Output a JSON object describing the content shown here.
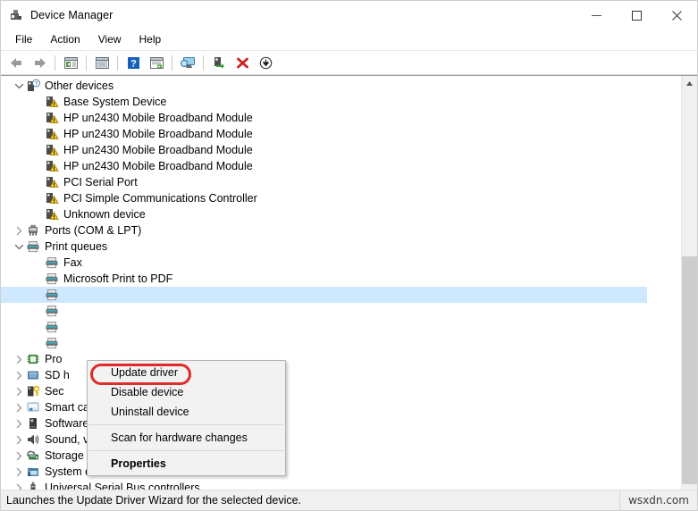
{
  "window": {
    "title": "Device Manager",
    "icon": "device-manager-icon",
    "controls": [
      {
        "name": "minimize-button",
        "glyph": "minimize"
      },
      {
        "name": "maximize-button",
        "glyph": "maximize"
      },
      {
        "name": "close-button",
        "glyph": "close"
      }
    ]
  },
  "menubar": {
    "items": [
      {
        "label": "File"
      },
      {
        "label": "Action"
      },
      {
        "label": "View"
      },
      {
        "label": "Help"
      }
    ]
  },
  "toolbar": {
    "buttons": [
      {
        "name": "back-icon",
        "title": "Back"
      },
      {
        "name": "forward-icon",
        "title": "Forward"
      },
      {
        "name": "show-hide-console-tree-icon",
        "title": "Show/Hide Console Tree"
      },
      {
        "name": "properties-icon",
        "title": "Properties"
      },
      {
        "name": "help-icon",
        "title": "Help"
      },
      {
        "name": "update-driver-icon",
        "title": "Update driver"
      },
      {
        "name": "scan-hardware-changes-icon",
        "title": "Scan for hardware changes"
      },
      {
        "name": "enable-device-icon",
        "title": "Enable device"
      },
      {
        "name": "uninstall-device-icon",
        "title": "Uninstall device"
      },
      {
        "name": "disable-device-icon",
        "title": "Disable device"
      }
    ]
  },
  "tree": {
    "nodes": [
      {
        "label": "Other devices",
        "icon": "unknown-device-icon",
        "indent": 1,
        "twisty": "expanded"
      },
      {
        "label": "Base System Device",
        "icon": "warning-device-icon",
        "indent": 2,
        "twisty": "none"
      },
      {
        "label": "HP un2430 Mobile Broadband Module",
        "icon": "warning-device-icon",
        "indent": 2,
        "twisty": "none"
      },
      {
        "label": "HP un2430 Mobile Broadband Module",
        "icon": "warning-device-icon",
        "indent": 2,
        "twisty": "none"
      },
      {
        "label": "HP un2430 Mobile Broadband Module",
        "icon": "warning-device-icon",
        "indent": 2,
        "twisty": "none"
      },
      {
        "label": "HP un2430 Mobile Broadband Module",
        "icon": "warning-device-icon",
        "indent": 2,
        "twisty": "none"
      },
      {
        "label": "PCI Serial Port",
        "icon": "warning-device-icon",
        "indent": 2,
        "twisty": "none"
      },
      {
        "label": "PCI Simple Communications Controller",
        "icon": "warning-device-icon",
        "indent": 2,
        "twisty": "none"
      },
      {
        "label": "Unknown device",
        "icon": "warning-device-icon",
        "indent": 2,
        "twisty": "none"
      },
      {
        "label": "Ports (COM & LPT)",
        "icon": "ports-icon",
        "indent": 1,
        "twisty": "collapsed"
      },
      {
        "label": "Print queues",
        "icon": "printer-icon",
        "indent": 1,
        "twisty": "expanded"
      },
      {
        "label": "Fax",
        "icon": "printer-icon",
        "indent": 2,
        "twisty": "none"
      },
      {
        "label": "Microsoft Print to PDF",
        "icon": "printer-icon",
        "indent": 2,
        "twisty": "none"
      },
      {
        "label": "",
        "icon": "printer-icon",
        "indent": 2,
        "twisty": "none",
        "selected": true
      },
      {
        "label": "",
        "icon": "printer-icon",
        "indent": 2,
        "twisty": "none"
      },
      {
        "label": "",
        "icon": "printer-icon",
        "indent": 2,
        "twisty": "none"
      },
      {
        "label": "",
        "icon": "printer-icon",
        "indent": 2,
        "twisty": "none"
      },
      {
        "label": "Pro",
        "icon": "processor-icon",
        "indent": 1,
        "twisty": "collapsed"
      },
      {
        "label": "SD h",
        "icon": "sd-host-icon",
        "indent": 1,
        "twisty": "collapsed"
      },
      {
        "label": "Sec",
        "icon": "security-devices-icon",
        "indent": 1,
        "twisty": "collapsed"
      },
      {
        "label": "Smart card readers",
        "icon": "smartcard-reader-icon",
        "indent": 1,
        "twisty": "collapsed"
      },
      {
        "label": "Software devices",
        "icon": "software-device-icon",
        "indent": 1,
        "twisty": "collapsed"
      },
      {
        "label": "Sound, video and game controllers",
        "icon": "sound-icon",
        "indent": 1,
        "twisty": "collapsed"
      },
      {
        "label": "Storage controllers",
        "icon": "storage-controller-icon",
        "indent": 1,
        "twisty": "collapsed"
      },
      {
        "label": "System devices",
        "icon": "system-device-icon",
        "indent": 1,
        "twisty": "collapsed"
      },
      {
        "label": "Universal Serial Bus controllers",
        "icon": "usb-icon",
        "indent": 1,
        "twisty": "collapsed"
      }
    ]
  },
  "context_menu": {
    "items": [
      {
        "label": "Update driver",
        "type": "item",
        "highlighted": true
      },
      {
        "label": "Disable device",
        "type": "item"
      },
      {
        "label": "Uninstall device",
        "type": "item"
      },
      {
        "type": "separator"
      },
      {
        "label": "Scan for hardware changes",
        "type": "item"
      },
      {
        "type": "separator"
      },
      {
        "label": "Properties",
        "type": "item",
        "bold": true
      }
    ],
    "highlight_color": "#e02b28"
  },
  "statusbar": {
    "text": "Launches the Update Driver Wizard for the selected device.",
    "watermark": "wsxdn.com"
  },
  "scrollbar": {
    "up_arrow": "scroll-up-arrow",
    "down_arrow": "scroll-down-arrow"
  }
}
